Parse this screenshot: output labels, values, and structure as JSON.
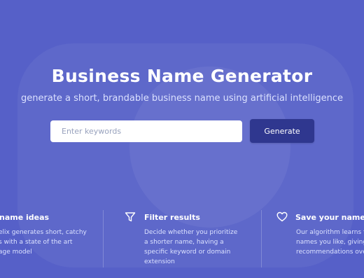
{
  "hero": {
    "title": "Business Name Generator",
    "subtitle": "generate a short, brandable business name using artificial intelligence"
  },
  "search": {
    "placeholder": "Enter keywords",
    "button_label": "Generate"
  },
  "features": [
    {
      "icon": "lightbulb-icon",
      "title": "name ideas",
      "lines": [
        "elix generates short, catchy",
        "s with a state of the art",
        "age model"
      ]
    },
    {
      "icon": "filter-icon",
      "title": "Filter results",
      "lines": [
        "Decide whether you prioritize",
        "a shorter name, having a",
        "specific keyword or domain",
        "extension"
      ]
    },
    {
      "icon": "heart-icon",
      "title": "Save your names",
      "lines": [
        "Our algorithm learns fr",
        "names you like, giving",
        "recommendations ove"
      ]
    }
  ],
  "colors": {
    "background": "#5660c8",
    "button": "#2f378f",
    "subtitle": "#dbe1ff"
  }
}
